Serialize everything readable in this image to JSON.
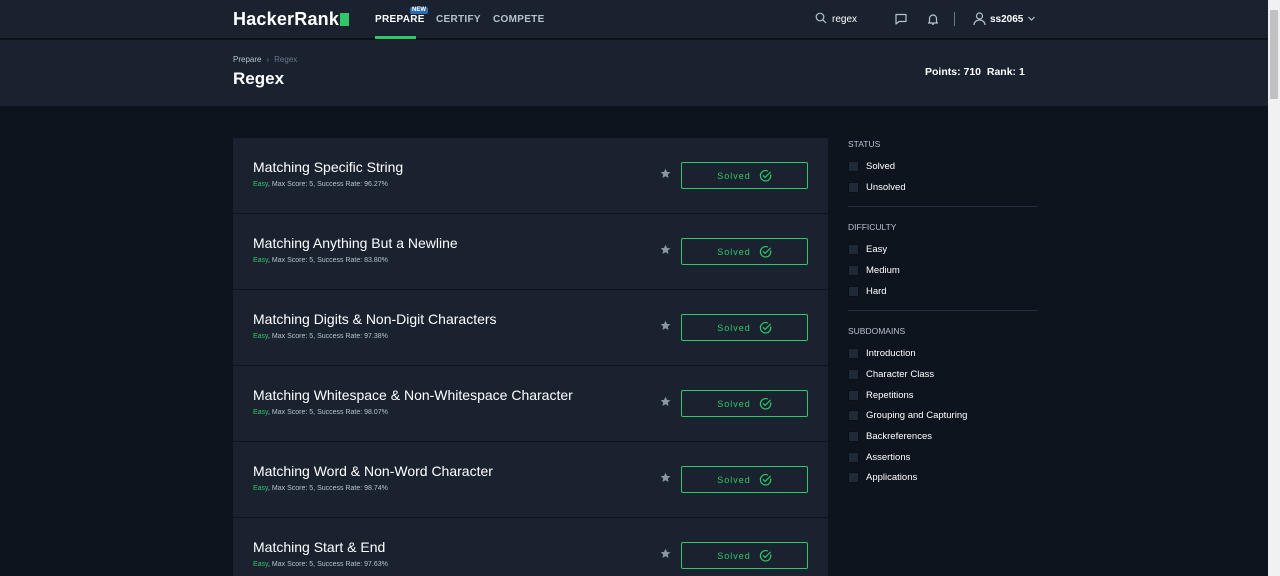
{
  "nav": {
    "logo": "HackerRank",
    "tabs": [
      {
        "label": "PREPARE",
        "active": true,
        "badge": "NEW"
      },
      {
        "label": "CERTIFY",
        "active": false
      },
      {
        "label": "COMPETE",
        "active": false
      }
    ],
    "search_value": "regex",
    "username": "ss2065",
    "icons": [
      "search-icon",
      "chat-icon",
      "bell-icon",
      "user-icon",
      "chevron-down-icon"
    ]
  },
  "header": {
    "breadcrumb": [
      "Prepare",
      "Regex"
    ],
    "title": "Regex",
    "points_label": "Points: 710",
    "rank_label": "Rank: 1"
  },
  "challenges": [
    {
      "title": "Matching Specific String",
      "difficulty": "Easy",
      "meta": ", Max Score: 5, Success Rate: 96.27%",
      "status": "Solved"
    },
    {
      "title": "Matching Anything But a Newline",
      "difficulty": "Easy",
      "meta": ", Max Score: 5, Success Rate: 83.80%",
      "status": "Solved"
    },
    {
      "title": "Matching Digits & Non-Digit Characters",
      "difficulty": "Easy",
      "meta": ", Max Score: 5, Success Rate: 97.38%",
      "status": "Solved"
    },
    {
      "title": "Matching Whitespace & Non-Whitespace Character",
      "difficulty": "Easy",
      "meta": ", Max Score: 5, Success Rate: 98.07%",
      "status": "Solved"
    },
    {
      "title": "Matching Word & Non-Word Character",
      "difficulty": "Easy",
      "meta": ", Max Score: 5, Success Rate: 98.74%",
      "status": "Solved"
    },
    {
      "title": "Matching Start & End",
      "difficulty": "Easy",
      "meta": ", Max Score: 5, Success Rate: 97.63%",
      "status": "Solved"
    }
  ],
  "filters": {
    "status": {
      "title": "STATUS",
      "items": [
        "Solved",
        "Unsolved"
      ]
    },
    "difficulty": {
      "title": "DIFFICULTY",
      "items": [
        "Easy",
        "Medium",
        "Hard"
      ]
    },
    "subdomains": {
      "title": "SUBDOMAINS",
      "items": [
        "Introduction",
        "Character Class",
        "Repetitions",
        "Grouping and Capturing",
        "Backreferences",
        "Assertions",
        "Applications"
      ]
    }
  },
  "colors": {
    "accent": "#2ec866",
    "background": "#0e141e",
    "panel": "#1a2230"
  }
}
